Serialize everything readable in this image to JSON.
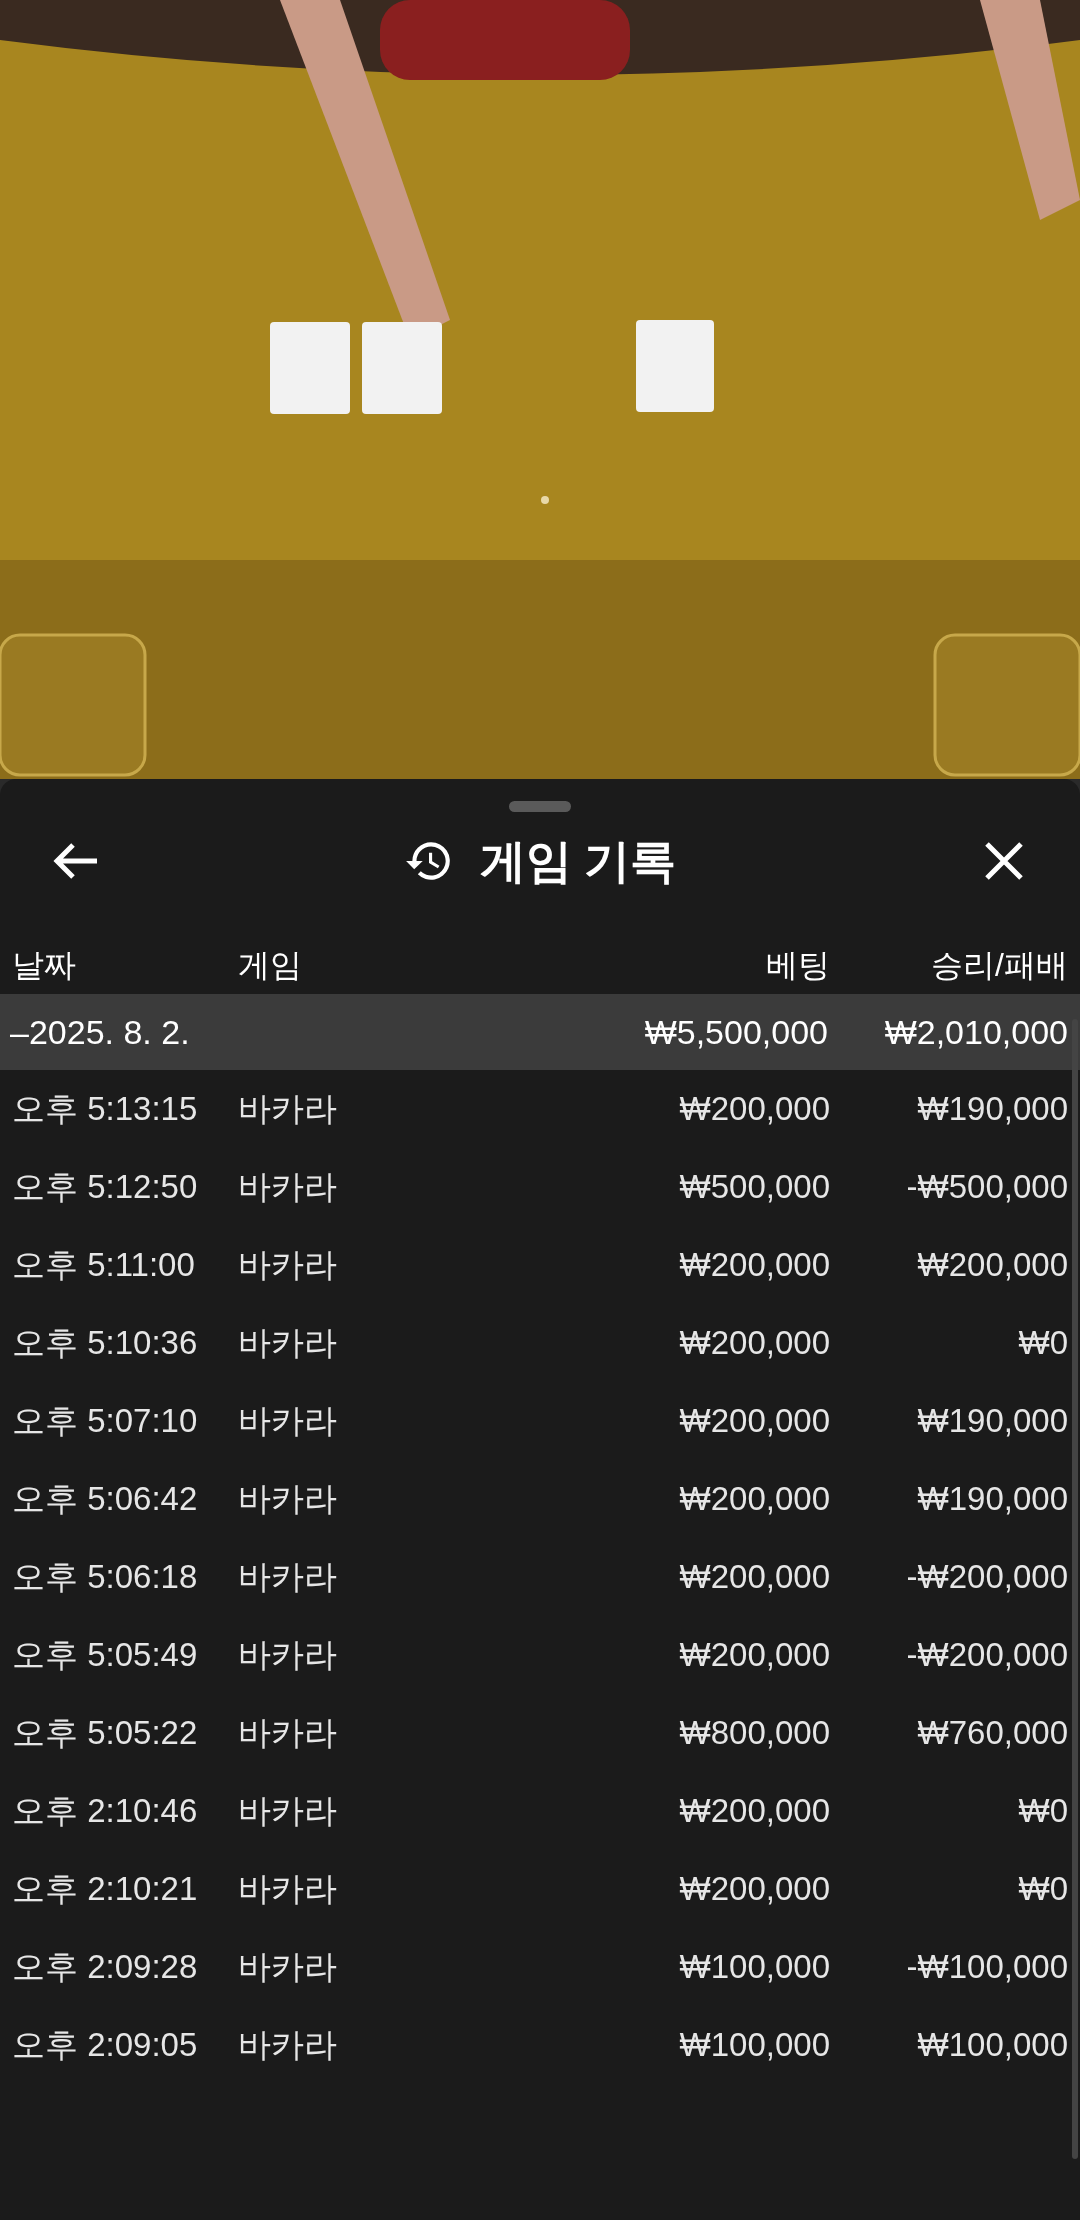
{
  "panel": {
    "title": "게임 기록"
  },
  "table": {
    "columns": [
      "날짜",
      "게임",
      "베팅",
      "승리/패배"
    ],
    "summary": {
      "date": "–2025. 8. 2.",
      "bet": "₩5,500,000",
      "result": "₩2,010,000"
    },
    "rows": [
      {
        "time": "오후 5:13:15",
        "game": "바카라",
        "bet": "₩200,000",
        "result": "₩190,000"
      },
      {
        "time": "오후 5:12:50",
        "game": "바카라",
        "bet": "₩500,000",
        "result": "-₩500,000"
      },
      {
        "time": "오후 5:11:00",
        "game": "바카라",
        "bet": "₩200,000",
        "result": "₩200,000"
      },
      {
        "time": "오후 5:10:36",
        "game": "바카라",
        "bet": "₩200,000",
        "result": "₩0"
      },
      {
        "time": "오후 5:07:10",
        "game": "바카라",
        "bet": "₩200,000",
        "result": "₩190,000"
      },
      {
        "time": "오후 5:06:42",
        "game": "바카라",
        "bet": "₩200,000",
        "result": "₩190,000"
      },
      {
        "time": "오후 5:06:18",
        "game": "바카라",
        "bet": "₩200,000",
        "result": "-₩200,000"
      },
      {
        "time": "오후 5:05:49",
        "game": "바카라",
        "bet": "₩200,000",
        "result": "-₩200,000"
      },
      {
        "time": "오후 5:05:22",
        "game": "바카라",
        "bet": "₩800,000",
        "result": "₩760,000"
      },
      {
        "time": "오후 2:10:46",
        "game": "바카라",
        "bet": "₩200,000",
        "result": "₩0"
      },
      {
        "time": "오후 2:10:21",
        "game": "바카라",
        "bet": "₩200,000",
        "result": "₩0"
      },
      {
        "time": "오후 2:09:28",
        "game": "바카라",
        "bet": "₩100,000",
        "result": "-₩100,000"
      },
      {
        "time": "오후 2:09:05",
        "game": "바카라",
        "bet": "₩100,000",
        "result": "₩100,000"
      }
    ]
  }
}
